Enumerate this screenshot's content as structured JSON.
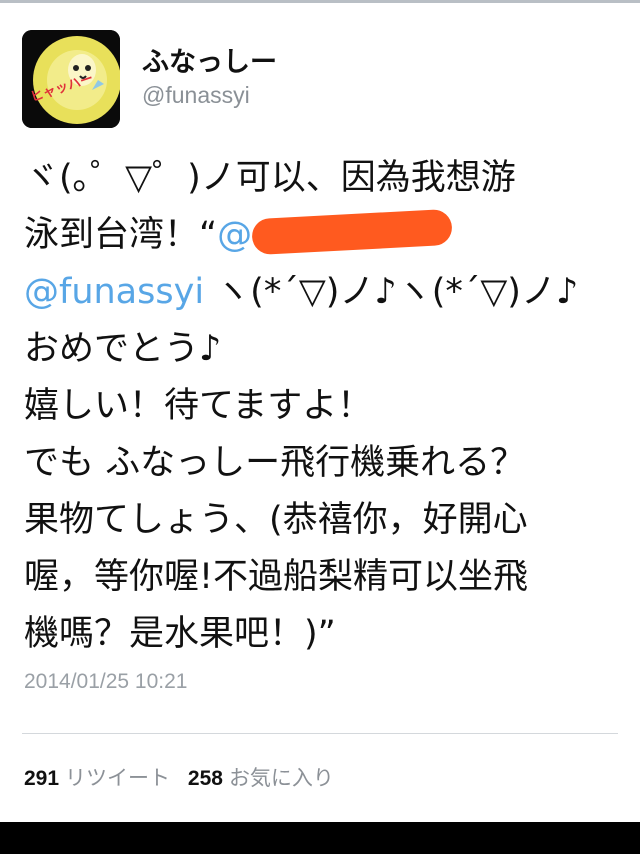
{
  "account": {
    "name": "ふなっしー",
    "handle": "@funassyi",
    "avatar_badge_text": "ヒャッハー"
  },
  "tweet": {
    "line1": "ヾ(｡゜▽゜)ノ可以、因為我想游",
    "line2_prefix": "泳到台湾！“",
    "line2_mention": "@",
    "line3_mention": "@funassyi",
    "line3_rest": " ヽ(*´▽)ノ♪ヽ(*´▽)ノ♪",
    "line4": "おめでとう♪",
    "line5": "嬉しい！待てますよ！",
    "line6": "でも ふなっしー飛行機乗れる？",
    "line7": "果物てしょう、(恭禧你，好開心",
    "line8": "喔，等你喔!不過船梨精可以坐飛",
    "line9": "機嗎？是水果吧！)”"
  },
  "timestamp": "2014/01/25 10:21",
  "stats": {
    "retweets_count": "291",
    "retweets_label": "リツイート",
    "favorites_count": "258",
    "favorites_label": "お気に入り"
  },
  "colors": {
    "link": "#58a6e6",
    "redaction": "#ff5a1f",
    "secondary_text": "#8c9197"
  }
}
